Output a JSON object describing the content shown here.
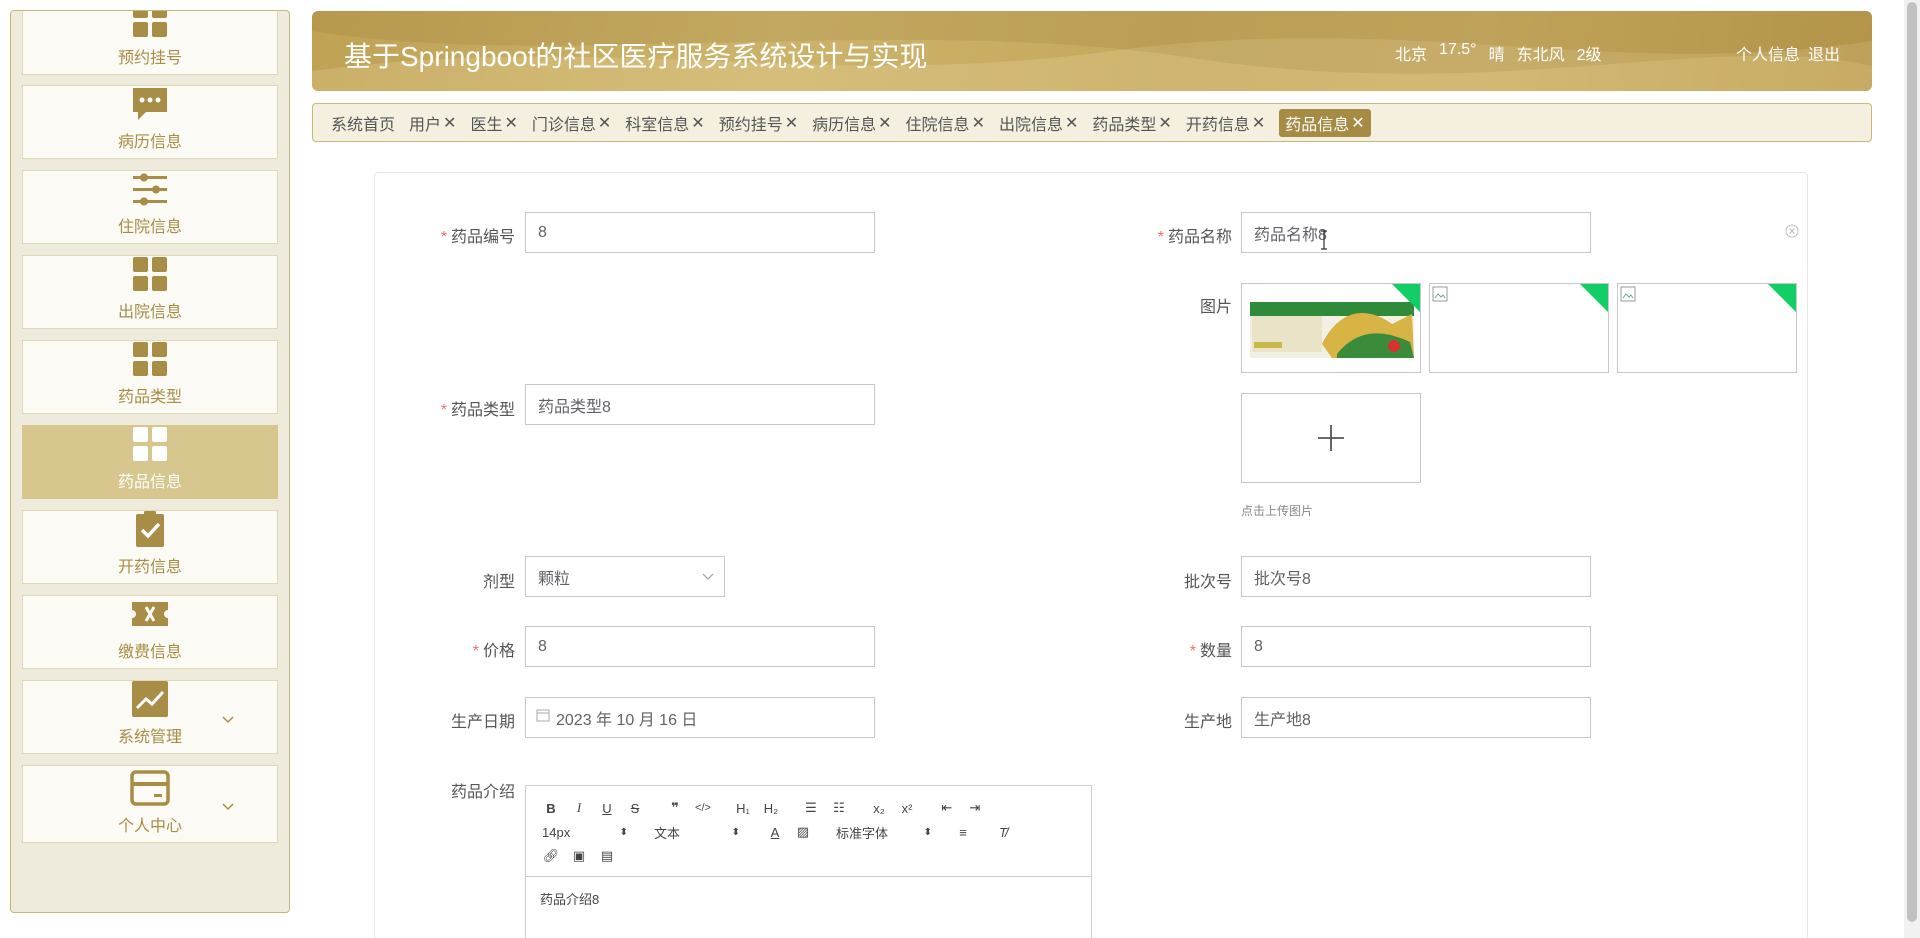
{
  "sidebar": {
    "items": [
      {
        "label": "预约挂号",
        "icon": "grid-icon"
      },
      {
        "label": "病历信息",
        "icon": "chat-dots-icon"
      },
      {
        "label": "住院信息",
        "icon": "sliders-icon"
      },
      {
        "label": "出院信息",
        "icon": "grid-icon"
      },
      {
        "label": "药品类型",
        "icon": "grid-icon"
      },
      {
        "label": "药品信息",
        "icon": "grid-icon",
        "active": true
      },
      {
        "label": "开药信息",
        "icon": "clipboard-check-icon"
      },
      {
        "label": "缴费信息",
        "icon": "ticket-icon"
      },
      {
        "label": "系统管理",
        "icon": "chart-icon",
        "expandable": true
      },
      {
        "label": "个人中心",
        "icon": "card-icon",
        "expandable": true
      }
    ]
  },
  "header": {
    "title": "基于Springboot的社区医疗服务系统设计与实现",
    "weather": {
      "city": "北京",
      "temp": "17.5°",
      "condition": "晴",
      "wind": "东北风",
      "level": "2级"
    },
    "profile_link": "个人信息",
    "logout_link": "退出"
  },
  "tabs": [
    {
      "label": "系统首页",
      "closable": false
    },
    {
      "label": "用户",
      "closable": true
    },
    {
      "label": "医生",
      "closable": true
    },
    {
      "label": "门诊信息",
      "closable": true
    },
    {
      "label": "科室信息",
      "closable": true
    },
    {
      "label": "预约挂号",
      "closable": true
    },
    {
      "label": "病历信息",
      "closable": true
    },
    {
      "label": "住院信息",
      "closable": true
    },
    {
      "label": "出院信息",
      "closable": true
    },
    {
      "label": "药品类型",
      "closable": true
    },
    {
      "label": "开药信息",
      "closable": true
    },
    {
      "label": "药品信息",
      "closable": true,
      "active": true
    }
  ],
  "tab_close_symbol": "✕",
  "form": {
    "drug_code": {
      "label": "药品编号",
      "value": "8"
    },
    "drug_name": {
      "label": "药品名称",
      "value": "药品名称8"
    },
    "image": {
      "label": "图片",
      "upload_hint": "点击上传图片"
    },
    "drug_type": {
      "label": "药品类型",
      "value": "药品类型8"
    },
    "dosage_form": {
      "label": "剂型",
      "value": "颗粒"
    },
    "batch_no": {
      "label": "批次号",
      "value": "批次号8"
    },
    "price": {
      "label": "价格",
      "value": "8"
    },
    "quantity": {
      "label": "数量",
      "value": "8"
    },
    "production_date": {
      "label": "生产日期",
      "value": "2023 年 10 月 16 日"
    },
    "origin": {
      "label": "生产地",
      "value": "生产地8"
    },
    "intro": {
      "label": "药品介绍",
      "value": "药品介绍8"
    }
  },
  "required_mark": "*",
  "editor": {
    "font_size": "14px",
    "text_style": "文本",
    "font_family": "标准字体"
  },
  "colors": {
    "accent": "#a68b45",
    "sidebar_active": "#d7c78f",
    "header": "#c4a85d",
    "required": "#f56c6c",
    "success_corner": "#13ce66"
  }
}
